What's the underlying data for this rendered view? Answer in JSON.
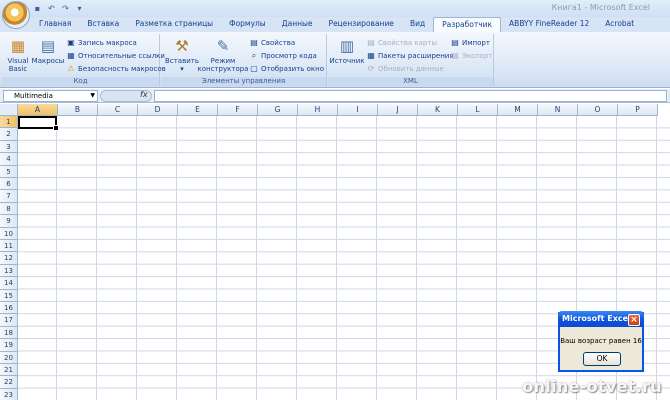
{
  "window": {
    "title": "Книга1 - Microsoft Excel"
  },
  "qat": {
    "save_icon": "save-icon",
    "undo_icon": "undo-icon",
    "redo_icon": "redo-icon"
  },
  "tabs": [
    {
      "label": "Главная",
      "active": false
    },
    {
      "label": "Вставка",
      "active": false
    },
    {
      "label": "Разметка страницы",
      "active": false
    },
    {
      "label": "Формулы",
      "active": false
    },
    {
      "label": "Данные",
      "active": false
    },
    {
      "label": "Рецензирование",
      "active": false
    },
    {
      "label": "Вид",
      "active": false
    },
    {
      "label": "Разработчик",
      "active": true
    },
    {
      "label": "ABBYY FineReader 12",
      "active": false
    },
    {
      "label": "Acrobat",
      "active": false
    }
  ],
  "ribbon": {
    "code": {
      "label": "Код",
      "visual_basic": "Visual Basic",
      "macros": "Макросы",
      "record_macro": "Запись макроса",
      "relative_refs": "Относительные ссылки",
      "macro_security": "Безопасность макросов"
    },
    "controls": {
      "label": "Элементы управления",
      "insert": "Вставить",
      "design_mode": "Режим конструктора",
      "properties": "Свойства",
      "view_code": "Просмотр кода",
      "run_dialog": "Отобразить окно"
    },
    "xml": {
      "label": "XML",
      "source": "Источник",
      "map_props": "Свойства карты",
      "expansion_packs": "Пакеты расширения",
      "refresh_data": "Обновить данные",
      "import": "Импорт",
      "export": "Экспорт"
    }
  },
  "formula_bar": {
    "name_box": "Multimedia",
    "fx": "fx",
    "value": ""
  },
  "columns": [
    "A",
    "B",
    "C",
    "D",
    "E",
    "F",
    "G",
    "H",
    "I",
    "J",
    "K",
    "L",
    "M",
    "N",
    "O",
    "P"
  ],
  "rows": [
    "1",
    "2",
    "3",
    "4",
    "5",
    "6",
    "7",
    "8",
    "9",
    "10",
    "11",
    "12",
    "13",
    "14",
    "15",
    "16",
    "17",
    "18",
    "19",
    "20",
    "21",
    "22",
    "23"
  ],
  "active_cell": "A1",
  "dialog": {
    "title": "Microsoft Excel",
    "message": "Ваш возраст равен 16",
    "ok": "OK"
  },
  "watermark": "online-otvet.ru",
  "colors": {
    "accent": "#15428b",
    "active_header": "#f1c15f",
    "dialog_title": "#0d55df"
  }
}
